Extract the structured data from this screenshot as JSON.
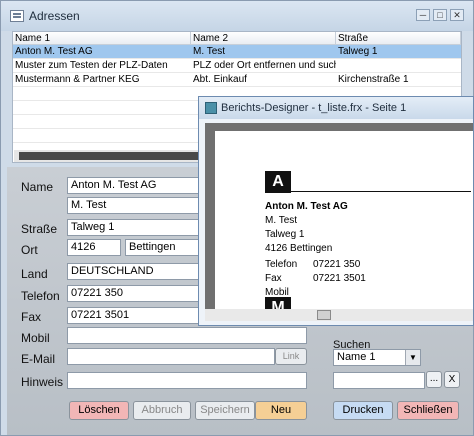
{
  "window": {
    "title": "Adressen",
    "btn_minimize": "─",
    "btn_maximize": "□",
    "btn_close": "✕"
  },
  "table": {
    "headers": [
      "Name 1",
      "Name 2",
      "Straße"
    ],
    "rows": [
      [
        "Anton M. Test AG",
        "M. Test",
        "Talweg 1"
      ],
      [
        "Muster zum Testen der PLZ-Daten",
        "PLZ oder Ort entfernen und sucher",
        ""
      ],
      [
        "Mustermann & Partner KEG",
        "Abt. Einkauf",
        "Kirchenstraße 1"
      ]
    ]
  },
  "form": {
    "name_label": "Name",
    "name1": "Anton M. Test AG",
    "name2": "M. Test",
    "strasse_label": "Straße",
    "strasse": "Talweg 1",
    "ort_label": "Ort",
    "plz": "4126",
    "ort": "Bettingen",
    "land_label": "Land",
    "land": "DEUTSCHLAND",
    "telefon_label": "Telefon",
    "telefon": "07221 350",
    "fax_label": "Fax",
    "fax": "07221 3501",
    "mobil_label": "Mobil",
    "mobil": "",
    "email_label": "E-Mail",
    "email": "",
    "link_button": "Link",
    "hinweis_label": "Hinweis",
    "hinweis": ""
  },
  "suchen": {
    "label": "Suchen",
    "selected": "Name 1",
    "ellipsis": "...",
    "close": "X"
  },
  "buttons": {
    "loeschen": "Löschen",
    "abbruch": "Abbruch",
    "speichern": "Speichern",
    "neu": "Neu",
    "drucken": "Drucken",
    "schliessen": "Schließen"
  },
  "designer": {
    "title": "Berichts-Designer - t_liste.frx - Seite 1",
    "group_a": "A",
    "company": "Anton M. Test AG",
    "contact": "M. Test",
    "street": "Talweg 1",
    "city": "4126 Bettingen",
    "tel_label": "Telefon",
    "tel": "07221 350",
    "fax_label": "Fax",
    "fax": "07221 3501",
    "mobil_label": "Mobil",
    "group_m": "M"
  },
  "colors": {
    "selected_row": "#9fc7ee",
    "delete_button": "#f2b6b6",
    "new_button": "#f5cf95",
    "print_button": "#c6dbf3",
    "close_button": "#f2b6b6"
  }
}
